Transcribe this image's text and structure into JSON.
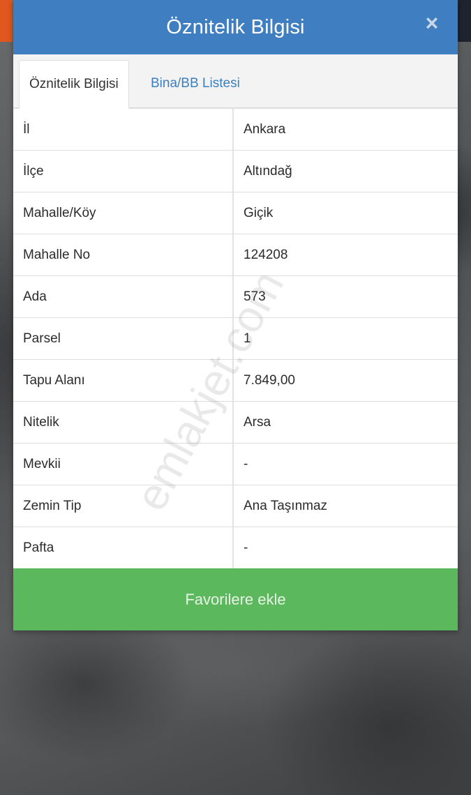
{
  "modal": {
    "title": "Öznitelik Bilgisi",
    "close_icon": "×"
  },
  "tabs": [
    {
      "label": "Öznitelik Bilgisi",
      "active": true
    },
    {
      "label": "Bina/BB Listesi",
      "active": false
    }
  ],
  "attributes": [
    {
      "label": "İl",
      "value": "Ankara"
    },
    {
      "label": "İlçe",
      "value": "Altındağ"
    },
    {
      "label": "Mahalle/Köy",
      "value": "Giçik"
    },
    {
      "label": "Mahalle No",
      "value": "124208"
    },
    {
      "label": "Ada",
      "value": "573"
    },
    {
      "label": "Parsel",
      "value": "1"
    },
    {
      "label": "Tapu Alanı",
      "value": "7.849,00"
    },
    {
      "label": "Nitelik",
      "value": "Arsa"
    },
    {
      "label": "Mevkii",
      "value": "-"
    },
    {
      "label": "Zemin Tip",
      "value": "Ana Taşınmaz"
    },
    {
      "label": "Pafta",
      "value": "-"
    }
  ],
  "actions": {
    "favorite_label": "Favorilere ekle"
  },
  "watermark": "emlakjet.com",
  "colors": {
    "header": "#3f7fc1",
    "tab_link": "#3a7fc0",
    "favorite_button": "#5cb85c"
  }
}
